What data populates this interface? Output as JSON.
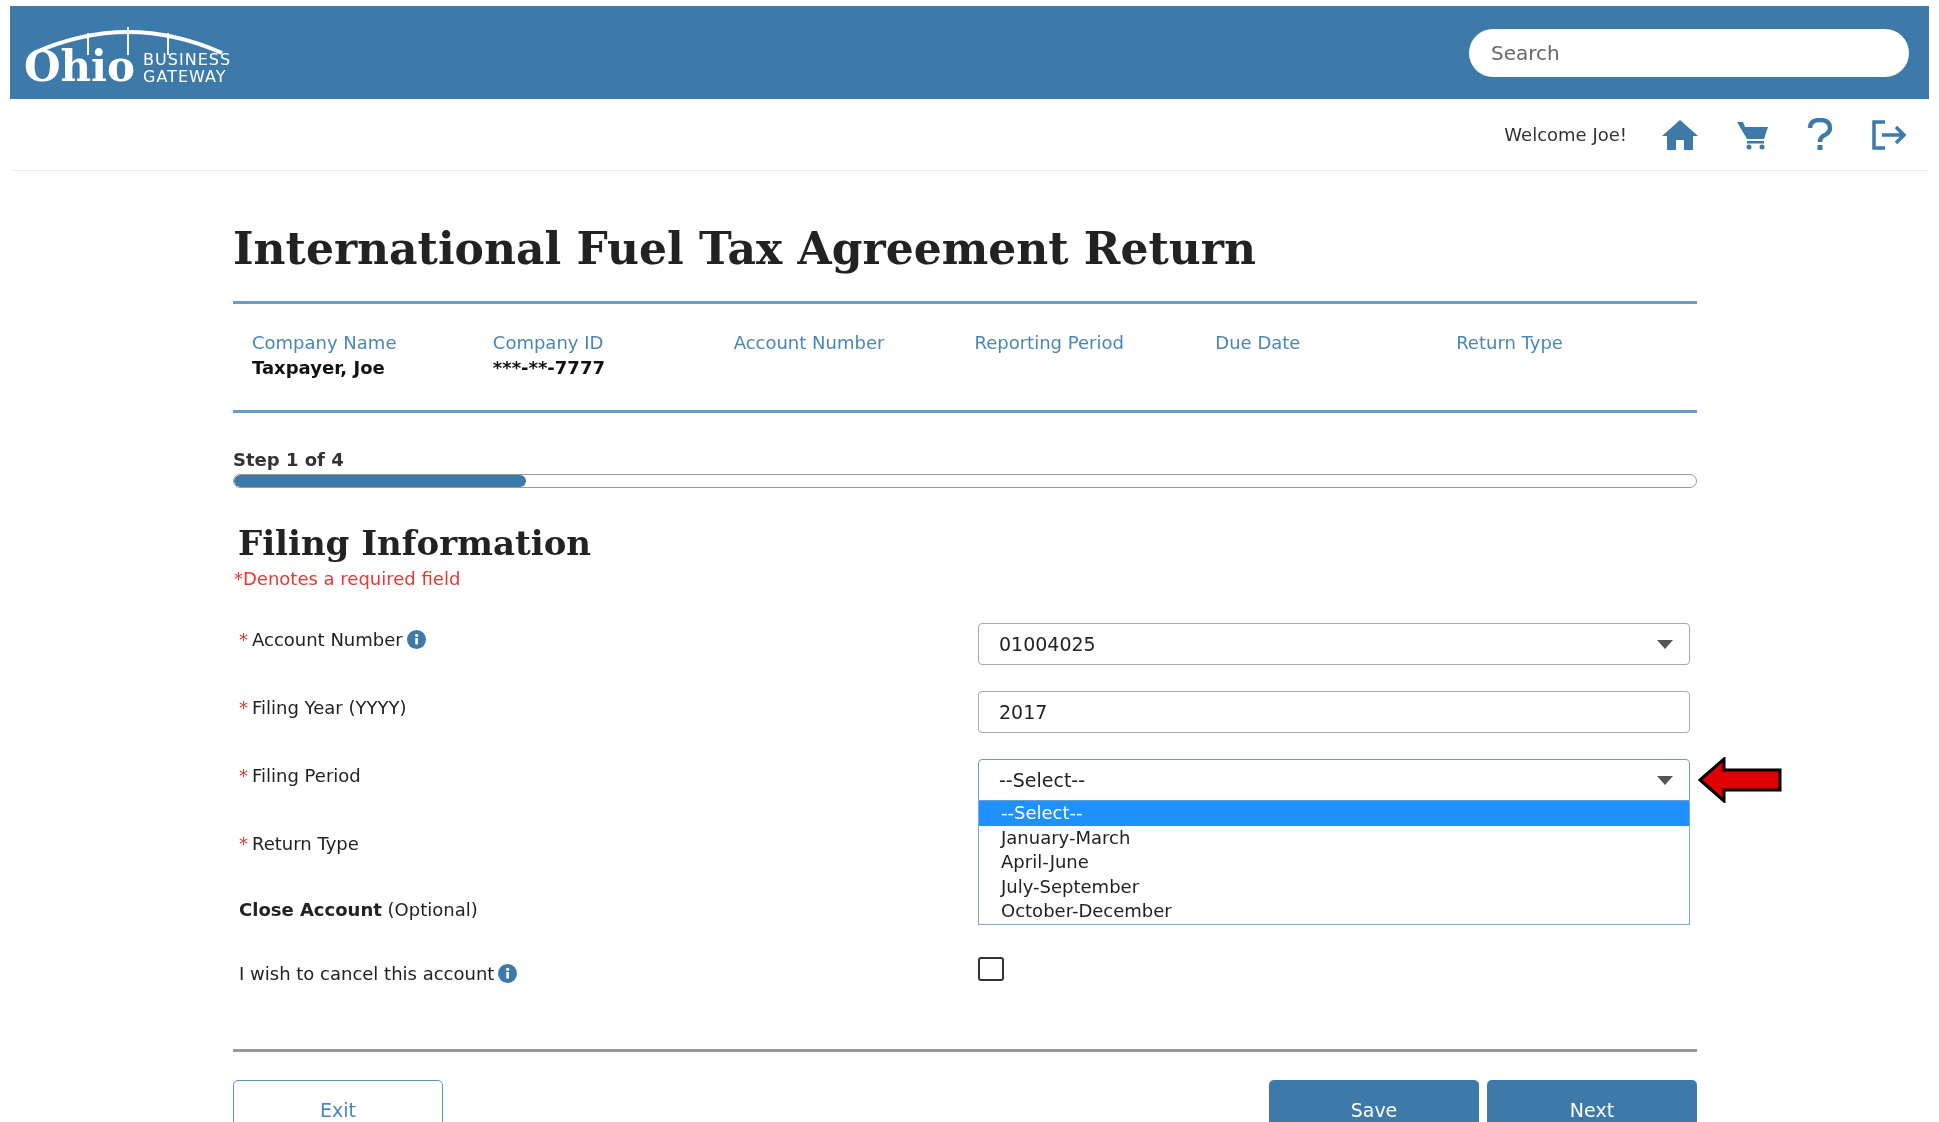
{
  "header": {
    "logo": {
      "word": "Ohio",
      "line1": "BUSINESS",
      "line2": "GATEWAY"
    },
    "search": {
      "placeholder": "Search"
    }
  },
  "user_bar": {
    "welcome": "Welcome Joe!"
  },
  "title": "International Fuel Tax Agreement Return",
  "summary": [
    {
      "label": "Company Name",
      "value": "Taxpayer, Joe"
    },
    {
      "label": "Company ID",
      "value": "***-**-7777"
    },
    {
      "label": "Account Number"
    },
    {
      "label": "Reporting Period"
    },
    {
      "label": "Due Date"
    },
    {
      "label": "Return Type"
    }
  ],
  "progress": {
    "step": "Step 1 of 4",
    "level": 0.2
  },
  "section": {
    "title": "Filing Information",
    "required_note": "*Denotes a required field"
  },
  "fields": [
    {
      "kind": "select",
      "required_mark": "*",
      "label": "Account Number",
      "info": true,
      "value": "01004025"
    },
    {
      "kind": "text",
      "required_mark": "*",
      "label": "Filing Year (YYYY)",
      "value": "2017"
    },
    {
      "kind": "select",
      "required_mark": "*",
      "label": "Filing Period",
      "value": "--Select--",
      "expanded": true,
      "pointer": true,
      "options": [
        {
          "label": "--Select--",
          "selected": true
        },
        {
          "label": "January-March",
          "selected": false
        },
        {
          "label": "April-June",
          "selected": false
        },
        {
          "label": "July-September",
          "selected": false
        },
        {
          "label": "October-December",
          "selected": false
        }
      ]
    },
    {
      "kind": "blank",
      "required_mark": "*",
      "label": "Return Type"
    },
    {
      "kind": "heading",
      "label": "Close Account",
      "note": "(Optional)"
    },
    {
      "kind": "checkbox",
      "label": "I wish to cancel this account",
      "info": true,
      "checked": false
    }
  ],
  "buttons": [
    {
      "label": "Exit",
      "kind": "secondary"
    },
    {
      "label": "Save",
      "kind": "primary"
    },
    {
      "label": "Next",
      "kind": "primary"
    }
  ]
}
